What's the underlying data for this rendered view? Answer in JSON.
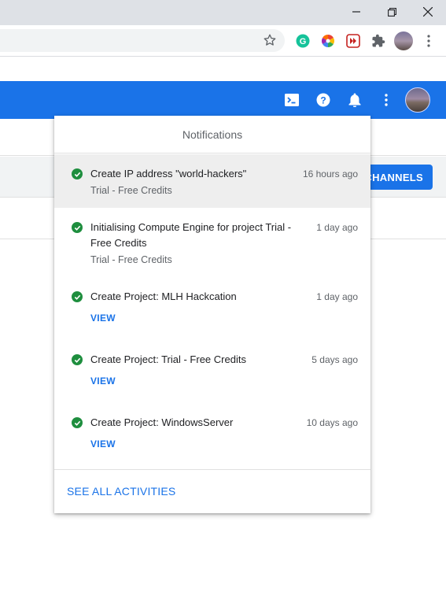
{
  "colors": {
    "accent": "#1a73e8",
    "success": "#1e8e3e"
  },
  "window": {
    "controls": [
      "minimize-icon",
      "restore-icon",
      "close-icon"
    ]
  },
  "toolbar": {
    "extensions": [
      "bookmark-star-icon",
      "grammarly-icon",
      "color-wheel-icon",
      "media-extension-icon",
      "puzzle-icon",
      "profile-avatar",
      "more-vert-icon"
    ]
  },
  "header": {
    "icons": [
      "cloud-shell-icon",
      "help-icon",
      "notifications-icon",
      "more-vert-icon",
      "avatar"
    ]
  },
  "background": {
    "channels_button": "CHANNELS"
  },
  "notifications": {
    "title": "Notifications",
    "items": [
      {
        "title": "Create IP address \"world-hackers\"",
        "subtitle": "Trial - Free Credits",
        "time": "16 hours ago"
      },
      {
        "title_line1": "Initialising Compute Engine for project Trial -",
        "title_line2": "Free Credits",
        "subtitle": "Trial - Free Credits",
        "time": "1 day ago"
      },
      {
        "title": "Create Project: MLH Hackcation",
        "action": "VIEW",
        "time": "1 day ago"
      },
      {
        "title": "Create Project: Trial - Free Credits",
        "action": "VIEW",
        "time": "5 days ago"
      },
      {
        "title": "Create Project: WindowsServer",
        "action": "VIEW",
        "time": "10 days ago"
      }
    ],
    "footer": "SEE ALL ACTIVITIES"
  }
}
